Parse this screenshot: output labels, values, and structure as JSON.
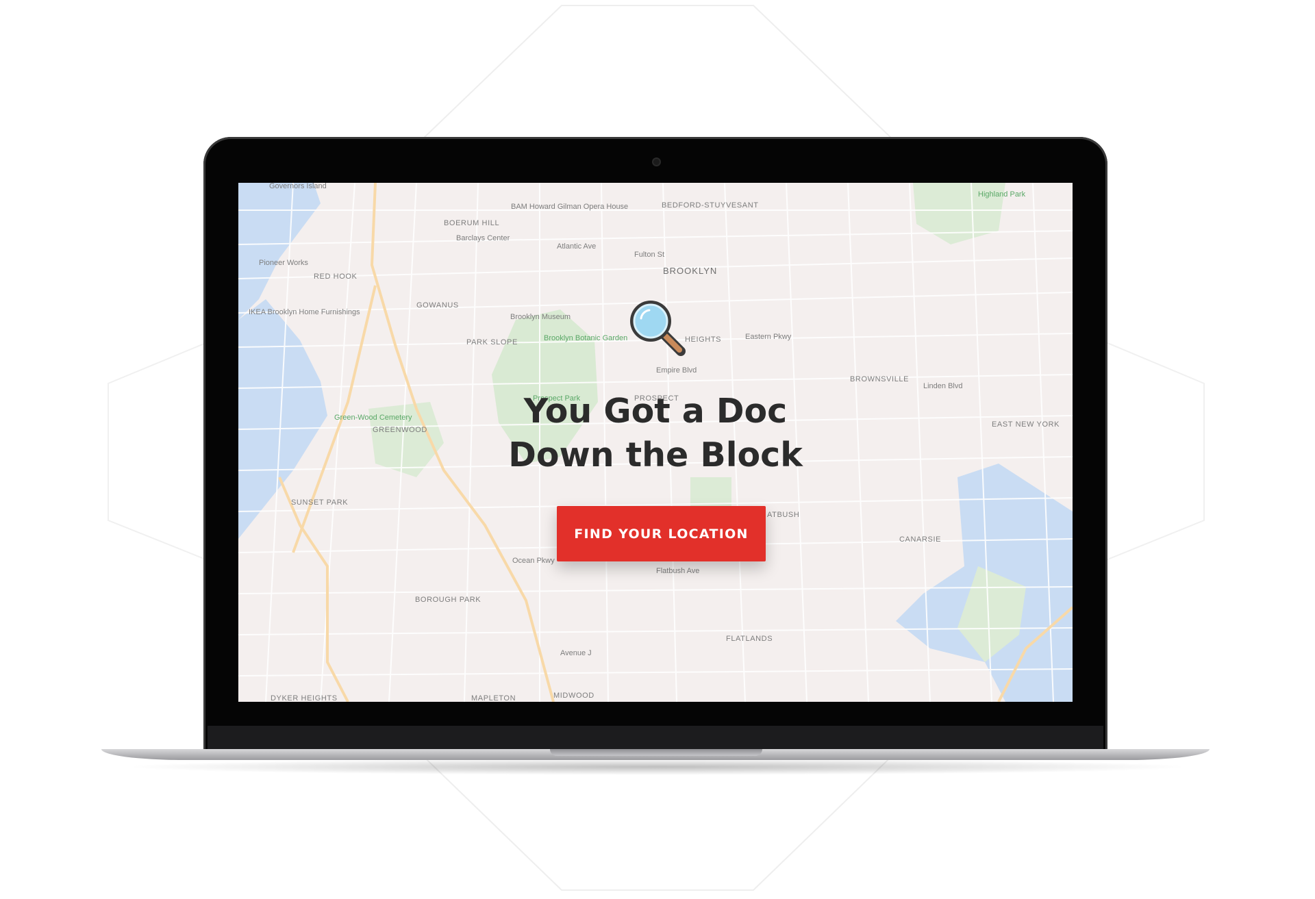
{
  "hero": {
    "headline_line1": "You Got a Doc",
    "headline_line2": "Down the Block",
    "cta_label": "FIND YOUR LOCATION"
  },
  "map": {
    "labels": {
      "governors_island": "Governors Island",
      "boerum_hill": "BOERUM HILL",
      "bam": "BAM Howard Gilman Opera House",
      "barclays": "Barclays Center",
      "bedford": "BEDFORD-STUYVESANT",
      "brooklyn": "BROOKLYN",
      "pioneer": "Pioneer Works",
      "red_hook": "RED HOOK",
      "gowanus": "GOWANUS",
      "ikea": "IKEA Brooklyn Home Furnishings",
      "brooklyn_museum": "Brooklyn Museum",
      "botanic": "Brooklyn Botanic Garden",
      "park_slope": "PARK SLOPE",
      "heights": "HEIGHTS",
      "prospect_park": "Prospect Park",
      "prospect": "PROSPECT",
      "greenwood_cemetery": "Green-Wood Cemetery",
      "greenwood": "GREENWOOD",
      "brownsville": "BROWNSVILLE",
      "east_new_york": "EAST NEW YORK",
      "sunset_park": "SUNSET PARK",
      "flatbush": "ATBUSH",
      "canarsie": "CANARSIE",
      "borough_park": "BOROUGH PARK",
      "flatlands": "FLATLANDS",
      "dyker": "DYKER HEIGHTS",
      "mapleton": "MAPLETON",
      "midwood": "MIDWOOD",
      "highland_park": "Highland Park",
      "atlantic_ave": "Atlantic Ave",
      "fulton_st": "Fulton St",
      "eastern_pkwy": "Eastern Pkwy",
      "empire_blvd": "Empire Blvd",
      "ocean_pkwy": "Ocean Pkwy",
      "flatbush_ave": "Flatbush Ave",
      "avenue_j": "Avenue J",
      "linden_blvd": "Linden Blvd"
    }
  }
}
